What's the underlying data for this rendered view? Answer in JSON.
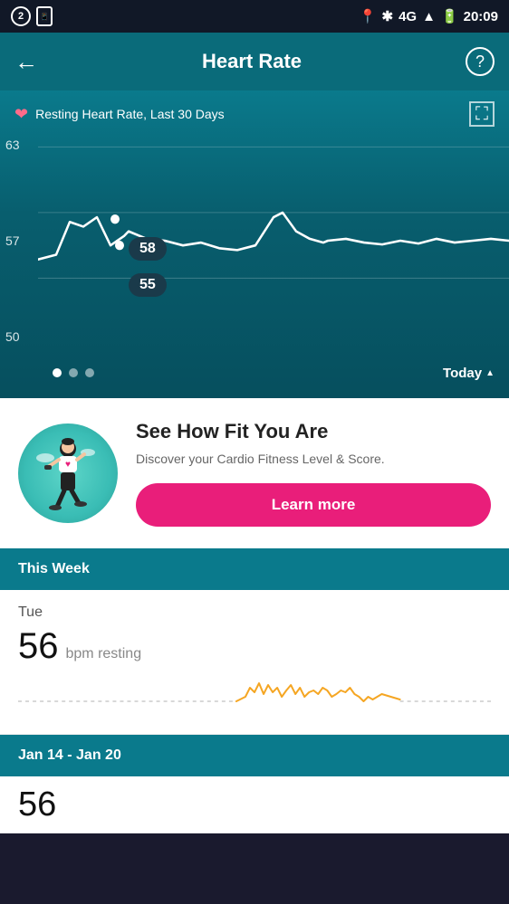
{
  "statusBar": {
    "leftIcons": [
      "2",
      "phone"
    ],
    "rightIcons": [
      "location",
      "bluetooth",
      "4G",
      "signal",
      "battery"
    ],
    "time": "20:09"
  },
  "header": {
    "title": "Heart Rate",
    "backLabel": "←",
    "helpLabel": "?"
  },
  "chart": {
    "subtitle": "Resting Heart Rate, Last 30 Days",
    "yLabels": [
      "63",
      "57",
      "50"
    ],
    "tooltips": [
      "58",
      "55"
    ],
    "dots": [
      true,
      false,
      false
    ],
    "todayLabel": "Today"
  },
  "card": {
    "title": "See How Fit You Are",
    "description": "Discover your Cardio Fitness Level & Score.",
    "buttonLabel": "Learn more"
  },
  "thisWeek": {
    "header": "This Week",
    "day": "Tue",
    "bpm": "56",
    "unit": "bpm resting"
  },
  "dateRange": {
    "header": "Jan 14 - Jan 20",
    "value": "56"
  }
}
